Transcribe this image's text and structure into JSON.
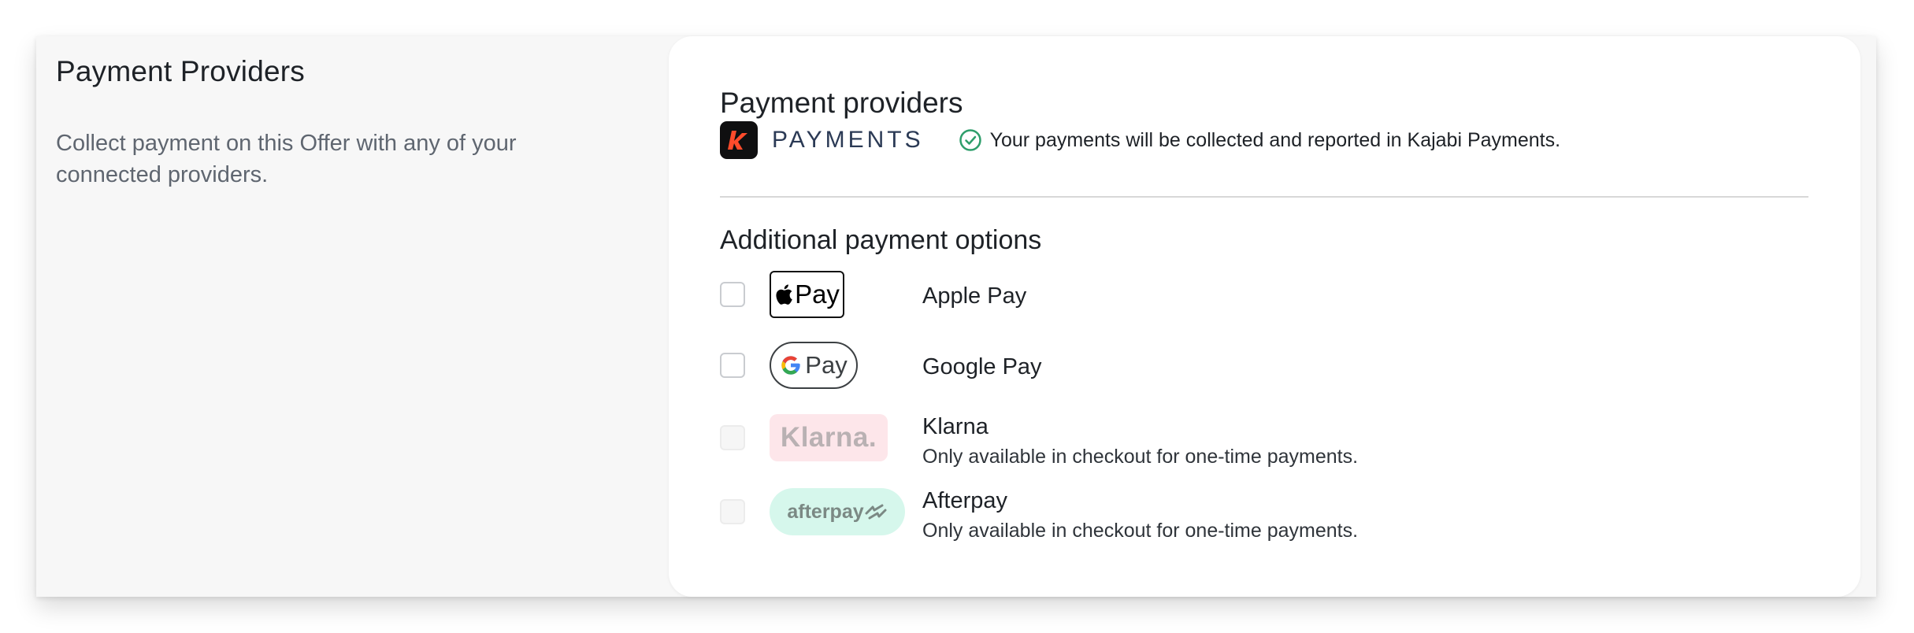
{
  "left_panel": {
    "title": "Payment Providers",
    "description": "Collect payment on this Offer with any of your connected providers."
  },
  "card": {
    "title": "Payment providers",
    "kajabi": {
      "logo_icon": "kajabi-k-logo",
      "wordmark": "PAYMENTS",
      "status_icon": "check-circle-icon",
      "status_text": "Your payments will be collected and reported in Kajabi Payments.",
      "status_color": "#2e9e6b"
    },
    "additional": {
      "title": "Additional payment options",
      "options": [
        {
          "name": "Apple Pay",
          "logo_text": "Pay",
          "icon": "apple-icon",
          "checked": false,
          "enabled": true,
          "note": ""
        },
        {
          "name": "Google Pay",
          "logo_text": "Pay",
          "icon": "google-g-icon",
          "checked": false,
          "enabled": true,
          "note": ""
        },
        {
          "name": "Klarna",
          "logo_text": "Klarna.",
          "checked": false,
          "enabled": false,
          "note": "Only available in checkout for one-time payments."
        },
        {
          "name": "Afterpay",
          "logo_text": "afterpay",
          "icon": "afterpay-arrows-icon",
          "checked": false,
          "enabled": false,
          "note": "Only available in checkout for one-time payments."
        }
      ]
    }
  },
  "colors": {
    "kajabi_accent": "#ff4b2b",
    "klarna_bg": "#fde6ea",
    "afterpay_bg": "#d6f7ec"
  }
}
